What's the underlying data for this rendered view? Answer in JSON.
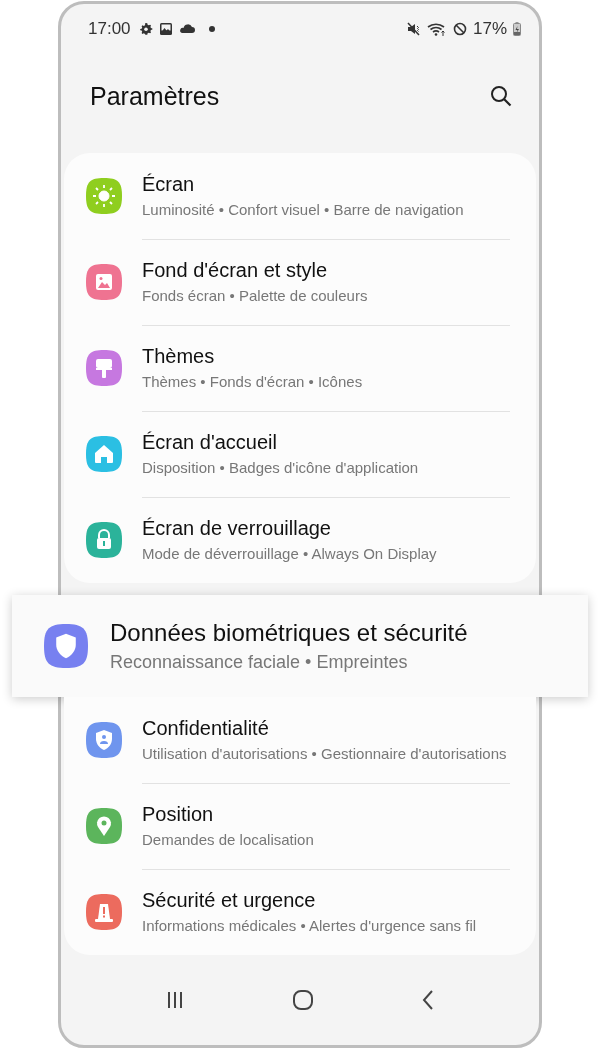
{
  "status_bar": {
    "time": "17:00",
    "battery": "17%"
  },
  "header": {
    "title": "Paramètres"
  },
  "groups": [
    {
      "items": [
        {
          "title": "Écran",
          "subtitle": "Luminosité • Confort visuel • Barre de navigation",
          "kind": "sun",
          "color": "#8fce1f",
          "highlighted": false
        },
        {
          "title": "Fond d'écran et style",
          "subtitle": "Fonds écran • Palette de couleurs",
          "kind": "image",
          "color": "#ef7391",
          "highlighted": false
        },
        {
          "title": "Thèmes",
          "subtitle": "Thèmes • Fonds d'écran • Icônes",
          "kind": "brush",
          "color": "#c678e0",
          "highlighted": false
        },
        {
          "title": "Écran d'accueil",
          "subtitle": "Disposition • Badges d'icône d'application",
          "kind": "home",
          "color": "#2bbfe3",
          "highlighted": false
        },
        {
          "title": "Écran de verrouillage",
          "subtitle": "Mode de déverrouillage • Always On Display",
          "kind": "lock",
          "color": "#2bb39a",
          "highlighted": false
        }
      ]
    },
    {
      "items": [
        {
          "title": "Données biométriques et sécurité",
          "subtitle": "Reconnaissance faciale • Empreintes",
          "kind": "shield",
          "color": "#7780f0",
          "highlighted": true
        }
      ]
    },
    {
      "items": [
        {
          "title": "Confidentialité",
          "subtitle": "Utilisation d'autorisations • Gestionnaire d'autorisations",
          "kind": "privacy",
          "color": "#6f95ee",
          "highlighted": false
        },
        {
          "title": "Position",
          "subtitle": "Demandes de localisation",
          "kind": "pin",
          "color": "#5cb55c",
          "highlighted": false
        },
        {
          "title": "Sécurité et urgence",
          "subtitle": "Informations médicales • Alertes d'urgence sans fil",
          "kind": "alert",
          "color": "#ec6b5e",
          "highlighted": false
        }
      ]
    }
  ]
}
